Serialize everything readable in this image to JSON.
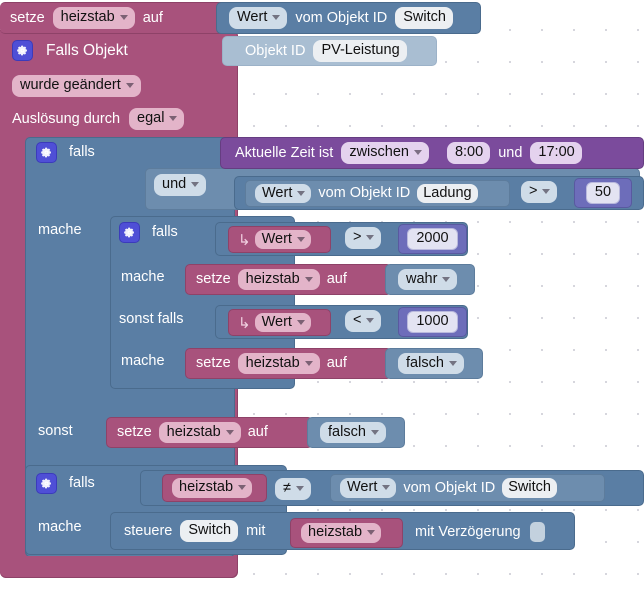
{
  "workspace": {
    "name": "blockly-workspace",
    "grid_spacing": 32,
    "background": "#ffffff"
  },
  "colors": {
    "pink": "#a8527c",
    "blue": "#5a7ea4",
    "purple": "#7b4b9c",
    "number": "#6d6dba",
    "ghost": "#a9bed2",
    "gear": "#4f4fd6"
  },
  "blocks": {
    "set_top": {
      "set_label": "setze",
      "variable": "heizstab",
      "to_label": "auf",
      "value_label": "Wert",
      "object_label": "vom Objekt ID",
      "object_id": "Switch"
    },
    "trigger": {
      "title": "Falls Objekt",
      "object_label": "Objekt ID",
      "object_id": "PV-Leistung",
      "condition": "wurde geändert",
      "source_label": "Auslösung durch",
      "source": "egal"
    },
    "if_outer": {
      "if_label": "falls",
      "do_label": "mache",
      "else_label": "sonst",
      "time_label": "Aktuelle Zeit ist",
      "time_op": "zwischen",
      "time_from": "8:00",
      "time_and": "und",
      "time_to": "17:00",
      "logic_op": "und",
      "value_label": "Wert",
      "object_label": "vom Objekt ID",
      "object_id": "Ladung",
      "compare_op": ">",
      "compare_value": "50"
    },
    "if_inner": {
      "if_label": "falls",
      "do_label": "mache",
      "elseif_label": "sonst falls",
      "do2_label": "mache",
      "cond1": {
        "value_label": "Wert",
        "op": ">",
        "number": "2000"
      },
      "action1": {
        "set_label": "setze",
        "variable": "heizstab",
        "to_label": "auf",
        "value": "wahr"
      },
      "cond2": {
        "value_label": "Wert",
        "op": "<",
        "number": "1000"
      },
      "action2": {
        "set_label": "setze",
        "variable": "heizstab",
        "to_label": "auf",
        "value": "falsch"
      }
    },
    "else_action": {
      "set_label": "setze",
      "variable": "heizstab",
      "to_label": "auf",
      "value": "falsch"
    },
    "if_bottom": {
      "if_label": "falls",
      "do_label": "mache",
      "left_var": "heizstab",
      "op": "≠",
      "value_label": "Wert",
      "object_label": "vom Objekt ID",
      "object_id": "Switch",
      "control_label": "steuere",
      "control_target": "Switch",
      "with_label": "mit",
      "control_var": "heizstab",
      "delay_label": "mit Verzögerung",
      "delay_value": ""
    }
  }
}
